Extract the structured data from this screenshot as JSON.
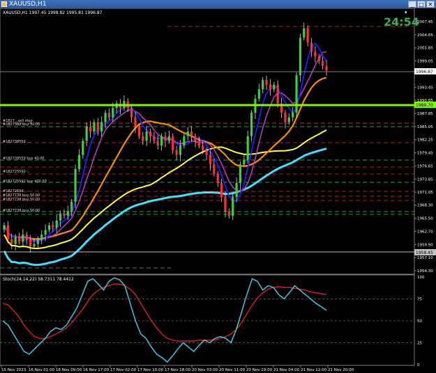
{
  "window": {
    "title": "XAUUSD,H1",
    "buttons": [
      "_",
      "□",
      "✕"
    ]
  },
  "main_chart": {
    "header": "XAUUSD,H1  1997.45 1998.82 1995.81 1996.87",
    "countdown": "24:54",
    "price_labels": [
      "2007.45",
      "2004.65",
      "2001.85",
      "1999.05",
      "1996.87",
      "1993.45",
      "1990.65",
      "1989.70",
      "1987.85",
      "1985.05",
      "1982.25",
      "1979.45",
      "1976.65",
      "1973.85",
      "1971.05",
      "1968.30",
      "1965.50",
      "1962.70",
      "1959.90",
      "1957.10",
      "1954.30"
    ],
    "current_price": "1996.87",
    "current_price_color": "#ffffff",
    "highlight_price": "1989.70",
    "highlight_color": "#7cfc00",
    "lower_marker_price": "1958.45",
    "order_labels": [
      "#1827...sell stop",
      "#1827388 buy 50.00",
      "#182738559 ...",
      "#182738559 buy 40.00",
      "#182725592 ...",
      "#182725592 buy 400.00",
      "#18272694 ...",
      "#1827738 buy 50.00",
      "#1827738 buy 50.00",
      "#1827738 buy 50.00"
    ],
    "ma_colors": {
      "fast": "#2020ff",
      "medium": "#c040c0",
      "slow": "#ff8c00",
      "longer": "#ffff40",
      "longest": "#40e0ff"
    }
  },
  "stochastic": {
    "header": "Stoch(24,14,22) 58.7311 78.4412",
    "levels": [
      "100",
      "75",
      "50",
      "25",
      "0"
    ],
    "main_color": "#40c8e8",
    "signal_color": "#d02020"
  },
  "time_axis": {
    "labels": [
      "15 Nov 2023",
      "16 Nov 01:00",
      "16 Nov 09:00",
      "16 Nov 17:00",
      "17 Nov 02:00",
      "17 Nov 10:00",
      "17 Nov 18:00",
      "20 Nov 03:00",
      "20 Nov 11:00",
      "20 Nov 19:00",
      "21 Nov 04:00",
      "21 Nov 12:00",
      "21 Nov 20:00"
    ]
  }
}
